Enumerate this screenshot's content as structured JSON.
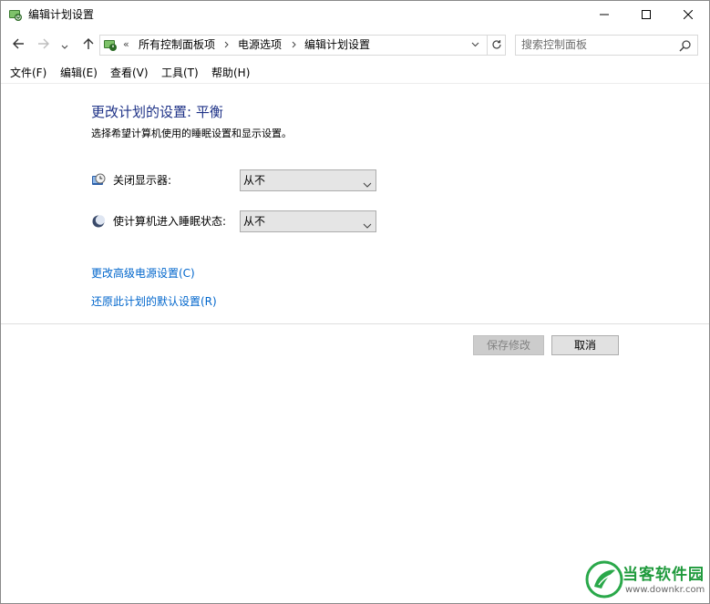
{
  "window": {
    "title": "编辑计划设置",
    "controls": {
      "minimize": "minimize-icon",
      "maximize": "maximize-icon",
      "close": "close-icon"
    }
  },
  "navigation": {
    "overflow_marker": "«",
    "breadcrumbs": [
      "所有控制面板项",
      "电源选项",
      "编辑计划设置"
    ],
    "search": {
      "placeholder": "搜索控制面板",
      "value": ""
    }
  },
  "menu": {
    "items": [
      "文件(F)",
      "编辑(E)",
      "查看(V)",
      "工具(T)",
      "帮助(H)"
    ]
  },
  "content": {
    "heading": "更改计划的设置: 平衡",
    "subtitle": "选择希望计算机使用的睡眠设置和显示设置。",
    "settings": [
      {
        "label": "关闭显示器:",
        "value": "从不",
        "icon": "display-timer-icon"
      },
      {
        "label": "使计算机进入睡眠状态:",
        "value": "从不",
        "icon": "sleep-moon-icon"
      }
    ],
    "links": [
      "更改高级电源设置(C)",
      "还原此计划的默认设置(R)"
    ],
    "buttons": {
      "save": "保存修改",
      "cancel": "取消"
    }
  },
  "watermark": {
    "name": "当客软件园",
    "url": "www.downkr.com"
  },
  "colors": {
    "heading": "#1e3287",
    "link": "#0066cc",
    "watermark": "#1f9a3c"
  }
}
